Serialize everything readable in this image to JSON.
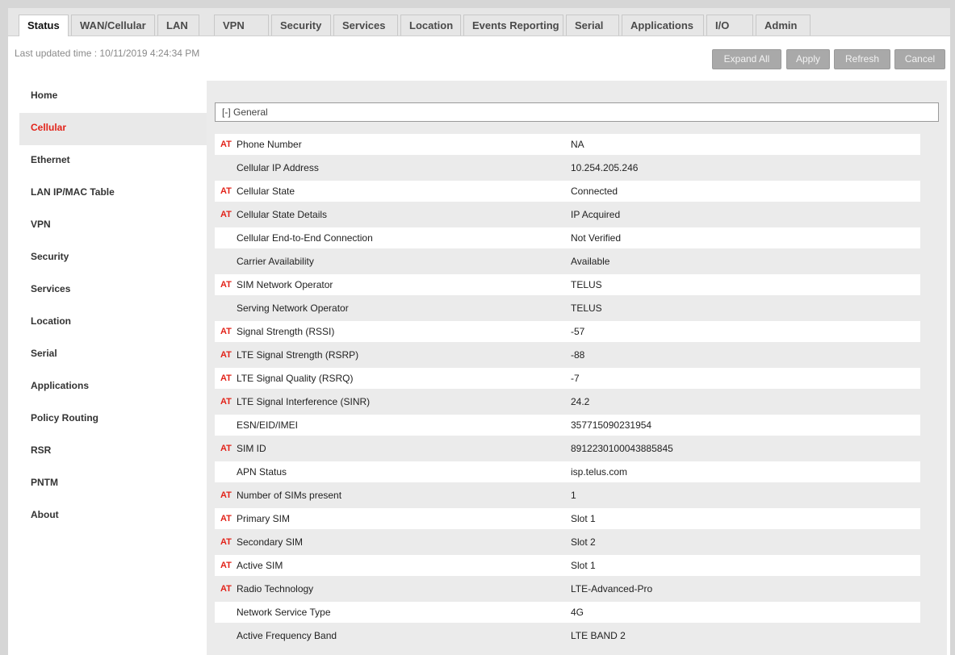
{
  "tabs": [
    {
      "label": "Status",
      "active": true
    },
    {
      "label": "WAN/Cellular"
    },
    {
      "label": "LAN"
    },
    {
      "label": "VPN"
    },
    {
      "label": "Security"
    },
    {
      "label": "Services"
    },
    {
      "label": "Location"
    },
    {
      "label": "Events Reporting"
    },
    {
      "label": "Serial"
    },
    {
      "label": "Applications"
    },
    {
      "label": "I/O"
    },
    {
      "label": "Admin"
    }
  ],
  "last_updated": "Last updated time : 10/11/2019 4:24:34 PM",
  "buttons": {
    "expand_all": "Expand All",
    "apply": "Apply",
    "refresh": "Refresh",
    "cancel": "Cancel"
  },
  "sidebar": {
    "items": [
      {
        "label": "Home"
      },
      {
        "label": "Cellular",
        "active": true
      },
      {
        "label": "Ethernet"
      },
      {
        "label": "LAN IP/MAC Table"
      },
      {
        "label": "VPN"
      },
      {
        "label": "Security"
      },
      {
        "label": "Services"
      },
      {
        "label": "Location"
      },
      {
        "label": "Serial"
      },
      {
        "label": "Applications"
      },
      {
        "label": "Policy Routing"
      },
      {
        "label": "RSR"
      },
      {
        "label": "PNTM"
      },
      {
        "label": "About"
      }
    ]
  },
  "section": {
    "title": "[-] General"
  },
  "at_label": "AT",
  "rows": [
    {
      "at": true,
      "label": "Phone Number",
      "value": "NA"
    },
    {
      "at": false,
      "label": "Cellular IP Address",
      "value": "10.254.205.246"
    },
    {
      "at": true,
      "label": "Cellular State",
      "value": "Connected"
    },
    {
      "at": true,
      "label": "Cellular State Details",
      "value": "IP Acquired"
    },
    {
      "at": false,
      "label": "Cellular End-to-End Connection",
      "value": "Not Verified"
    },
    {
      "at": false,
      "label": "Carrier Availability",
      "value": "Available"
    },
    {
      "at": true,
      "label": "SIM Network Operator",
      "value": "TELUS"
    },
    {
      "at": false,
      "label": "Serving Network Operator",
      "value": "TELUS"
    },
    {
      "at": true,
      "label": "Signal Strength (RSSI)",
      "value": "-57"
    },
    {
      "at": true,
      "label": "LTE Signal Strength (RSRP)",
      "value": "-88"
    },
    {
      "at": true,
      "label": "LTE Signal Quality (RSRQ)",
      "value": "-7"
    },
    {
      "at": true,
      "label": "LTE Signal Interference (SINR)",
      "value": "24.2"
    },
    {
      "at": false,
      "label": "ESN/EID/IMEI",
      "value": "357715090231954"
    },
    {
      "at": true,
      "label": "SIM ID",
      "value": "8912230100043885845"
    },
    {
      "at": false,
      "label": "APN Status",
      "value": "isp.telus.com"
    },
    {
      "at": true,
      "label": "Number of SIMs present",
      "value": "1"
    },
    {
      "at": true,
      "label": "Primary SIM",
      "value": "Slot 1"
    },
    {
      "at": true,
      "label": "Secondary SIM",
      "value": "Slot 2"
    },
    {
      "at": true,
      "label": "Active SIM",
      "value": "Slot 1"
    },
    {
      "at": true,
      "label": "Radio Technology",
      "value": "LTE-Advanced-Pro"
    },
    {
      "at": false,
      "label": "Network Service Type",
      "value": "4G"
    },
    {
      "at": false,
      "label": "Active Frequency Band",
      "value": "LTE BAND 2"
    }
  ]
}
